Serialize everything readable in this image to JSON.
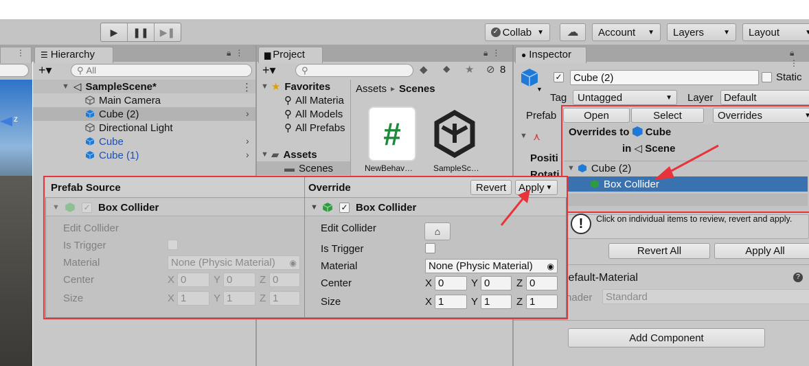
{
  "toolbar": {
    "play": "▶",
    "pause": "❚❚",
    "step": "▶❚",
    "collab": "Collab",
    "cloud": "☁",
    "account": "Account",
    "layers": "Layers",
    "layout": "Layout"
  },
  "hierarchy": {
    "tab": "Hierarchy",
    "add": "+▾",
    "search_placeholder": "All",
    "scene": "SampleScene*",
    "items": [
      "Main Camera",
      "Cube (2)",
      "Directional Light",
      "Cube",
      "Cube (1)"
    ]
  },
  "project": {
    "tab": "Project",
    "add": "+▾",
    "count": "8",
    "favorites": "Favorites",
    "fav_items": [
      "All Materia",
      "All Models",
      "All Prefabs"
    ],
    "assets": "Assets",
    "scenes": "Scenes",
    "breadcrumb_root": "Assets",
    "breadcrumb_sep": "▸",
    "breadcrumb_leaf": "Scenes",
    "files": [
      "NewBehav…",
      "SampleSc…"
    ]
  },
  "inspector": {
    "tab": "Inspector",
    "name": "Cube (2)",
    "static": "Static",
    "tag_label": "Tag",
    "tag_value": "Untagged",
    "layer_label": "Layer",
    "layer_value": "Default",
    "prefab_label": "Prefab",
    "open": "Open",
    "select": "Select",
    "overrides": "Overrides",
    "overrides_to": "Overrides to",
    "overrides_target": "Cube",
    "in": "in",
    "in_target": "Scene",
    "tree_parent": "Cube (2)",
    "tree_child": "Box Collider",
    "hint": "Click on individual items to review, revert and apply.",
    "revert_all": "Revert All",
    "apply_all": "Apply All",
    "pos_label": "Positi",
    "rot_label": "Rotati",
    "material_title": "Default-Material",
    "shader_label": "Shader",
    "shader_value": "Standard",
    "add_component": "Add Component"
  },
  "compare": {
    "left_header": "Prefab Source",
    "right_header": "Override",
    "revert": "Revert",
    "apply": "Apply",
    "component": "Box Collider",
    "edit_collider": "Edit Collider",
    "is_trigger": "Is Trigger",
    "material": "Material",
    "material_value": "None (Physic Material)",
    "center": "Center",
    "size": "Size",
    "x": "X",
    "y": "Y",
    "z": "Z",
    "center_values": [
      "0",
      "0",
      "0"
    ],
    "size_values": [
      "1",
      "1",
      "1"
    ]
  },
  "colors": {
    "highlight_red": "#e8333a",
    "selection_blue": "#3a72b0",
    "cube_blue": "#1e7ad6"
  }
}
